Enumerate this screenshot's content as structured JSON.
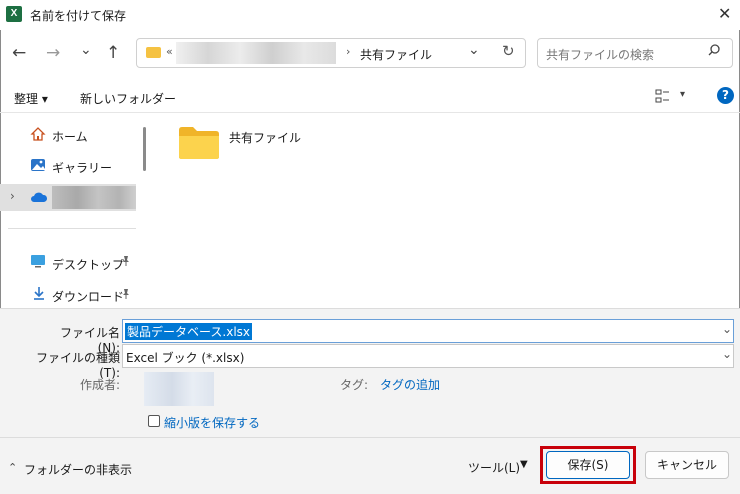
{
  "window": {
    "title": "名前を付けて保存",
    "app_icon": "excel-icon",
    "app_icon_text": "X"
  },
  "nav": {
    "back": "←",
    "forward": "→",
    "recent": "⌄",
    "up": "↑",
    "crumb_prefix": "«",
    "crumb_current": "共有ファイル",
    "refresh": "↻",
    "search_placeholder": "共有ファイルの検索"
  },
  "toolbar": {
    "organize_label": "整理 ▾",
    "new_folder_label": "新しいフォルダー"
  },
  "sidebar": {
    "items": [
      {
        "label": "ホーム",
        "icon": "home-icon"
      },
      {
        "label": "ギャラリー",
        "icon": "gallery-icon"
      },
      {
        "label": "",
        "icon": "onedrive-icon"
      },
      {
        "label": "デスクトップ",
        "icon": "desktop-icon"
      },
      {
        "label": "ダウンロード",
        "icon": "download-icon"
      }
    ]
  },
  "main": {
    "folders": [
      {
        "name": "共有ファイル"
      }
    ]
  },
  "form": {
    "filename_label": "ファイル名(N):",
    "filename_value": "製品データベース.xlsx",
    "filetype_label": "ファイルの種類(T):",
    "filetype_value": "Excel ブック (*.xlsx)",
    "author_label": "作成者:",
    "tags_label": "タグ:",
    "tags_link": "タグの追加",
    "thumbnail_label": "縮小版を保存する"
  },
  "footer": {
    "hide_folders_label": "フォルダーの非表示",
    "tools_label": "ツール(L)",
    "save_label": "保存(S)",
    "cancel_label": "キャンセル"
  },
  "colors": {
    "accent": "#0067c0",
    "highlight_box": "#c8000a",
    "selection": "#0078d4"
  }
}
